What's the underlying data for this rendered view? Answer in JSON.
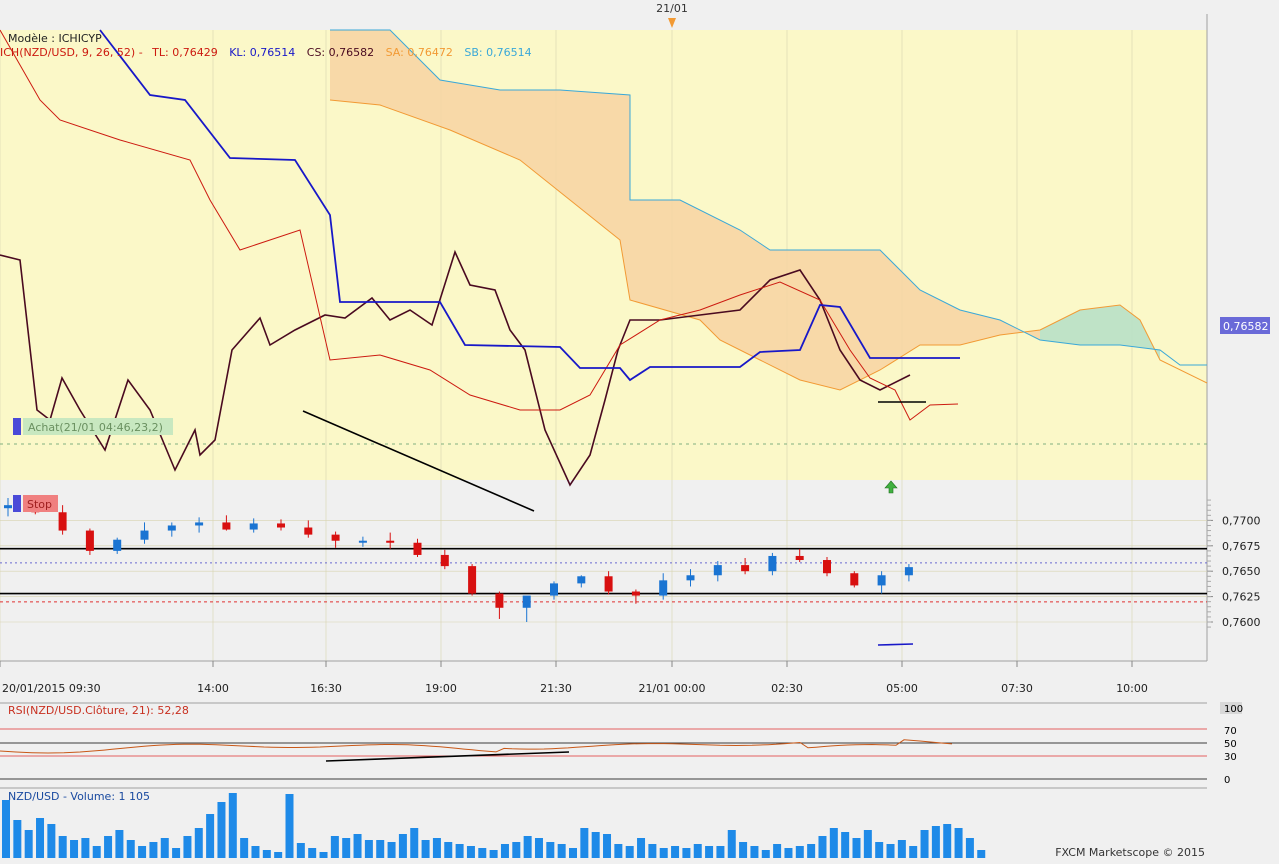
{
  "top_marker": {
    "label": "21/01"
  },
  "main_panel": {
    "legend": {
      "model": "Modèle : ICHICYP",
      "params": "ICH(NZD/USD, 9, 26, 52) -",
      "tl": "TL: 0,76429",
      "kl": "KL: 0,76514",
      "cs": "CS: 0,76582",
      "sa": "SA: 0,76472",
      "sb": "SB: 0,76514"
    },
    "buy_tag": "Achat(21/01 04:46,23,2)",
    "stop_tag": "Stop",
    "current_price_label": "0,76582",
    "y_ticks": [
      "0,7700",
      "0,7675",
      "0,7650",
      "0,7625",
      "0,7600"
    ],
    "x_ticks": [
      "20/01/2015 09:30",
      "14:00",
      "16:30",
      "19:00",
      "21:30",
      "21/01 00:00",
      "02:30",
      "05:00",
      "07:30",
      "10:00"
    ],
    "colors": {
      "bull": "#1a74d2",
      "bear": "#d81010",
      "background": "#fbf8c8",
      "tenkan": "#cc1a10",
      "kijun": "#1818c8",
      "chikou": "#4a0a20",
      "span_a": "#f29a34",
      "span_b": "#3aa8d8"
    }
  },
  "rsi_panel": {
    "label": "RSI(NZD/USD.Clôture, 21): 52,28",
    "ticks": [
      "100",
      "70",
      "50",
      "30",
      "0"
    ]
  },
  "volume_panel": {
    "label": "NZD/USD - Volume: 1 105",
    "copyright": "FXCM Marketscope © 2015"
  },
  "chart_data": {
    "type": "candlestick",
    "symbol": "NZD/USD",
    "timeframe": "30 min",
    "y_range": [
      0.7592,
      0.7722
    ],
    "levels": {
      "resistance": 0.76722,
      "support": 0.7628,
      "stop": 0.76198,
      "current_price": 0.76582
    },
    "candles_ohlc": [
      [
        0.7712,
        0.7722,
        0.7704,
        0.7715
      ],
      [
        0.7715,
        0.7722,
        0.7706,
        0.7708
      ],
      [
        0.7708,
        0.7715,
        0.7686,
        0.769
      ],
      [
        0.769,
        0.7692,
        0.7666,
        0.767
      ],
      [
        0.767,
        0.7683,
        0.7667,
        0.7681
      ],
      [
        0.7681,
        0.7698,
        0.7677,
        0.769
      ],
      [
        0.769,
        0.7698,
        0.7684,
        0.7695
      ],
      [
        0.7695,
        0.7703,
        0.7688,
        0.7698
      ],
      [
        0.7698,
        0.7705,
        0.769,
        0.7691
      ],
      [
        0.7691,
        0.7702,
        0.7688,
        0.7697
      ],
      [
        0.7697,
        0.7701,
        0.769,
        0.7693
      ],
      [
        0.7693,
        0.77,
        0.7683,
        0.7686
      ],
      [
        0.7686,
        0.7689,
        0.7673,
        0.768
      ],
      [
        0.768,
        0.7684,
        0.7674,
        0.768
      ],
      [
        0.768,
        0.7688,
        0.7672,
        0.7678
      ],
      [
        0.7678,
        0.7682,
        0.7664,
        0.7666
      ],
      [
        0.7666,
        0.7671,
        0.7652,
        0.7655
      ],
      [
        0.7655,
        0.7657,
        0.7626,
        0.7628
      ],
      [
        0.7628,
        0.763,
        0.7603,
        0.7614
      ],
      [
        0.7614,
        0.762,
        0.76,
        0.7626
      ],
      [
        0.7626,
        0.764,
        0.7622,
        0.7638
      ],
      [
        0.7638,
        0.7646,
        0.7634,
        0.7645
      ],
      [
        0.7645,
        0.765,
        0.7627,
        0.763
      ],
      [
        0.763,
        0.7632,
        0.7618,
        0.7626
      ],
      [
        0.7626,
        0.7648,
        0.7622,
        0.7641
      ],
      [
        0.7641,
        0.7652,
        0.7635,
        0.7646
      ],
      [
        0.7646,
        0.766,
        0.764,
        0.7656
      ],
      [
        0.7656,
        0.7663,
        0.7647,
        0.765
      ],
      [
        0.765,
        0.7668,
        0.7646,
        0.7665
      ],
      [
        0.7665,
        0.7672,
        0.7659,
        0.7661
      ],
      [
        0.7661,
        0.7664,
        0.7645,
        0.7648
      ],
      [
        0.7648,
        0.765,
        0.7634,
        0.7636
      ],
      [
        0.7636,
        0.765,
        0.7628,
        0.7646
      ],
      [
        0.7646,
        0.7657,
        0.764,
        0.7654
      ]
    ],
    "volumes": [
      880,
      680,
      550,
      730,
      600,
      420,
      380,
      490,
      820,
      1050
    ],
    "rsi": {
      "period": 21,
      "last": 52.28,
      "bounds": [
        30,
        70
      ]
    }
  }
}
